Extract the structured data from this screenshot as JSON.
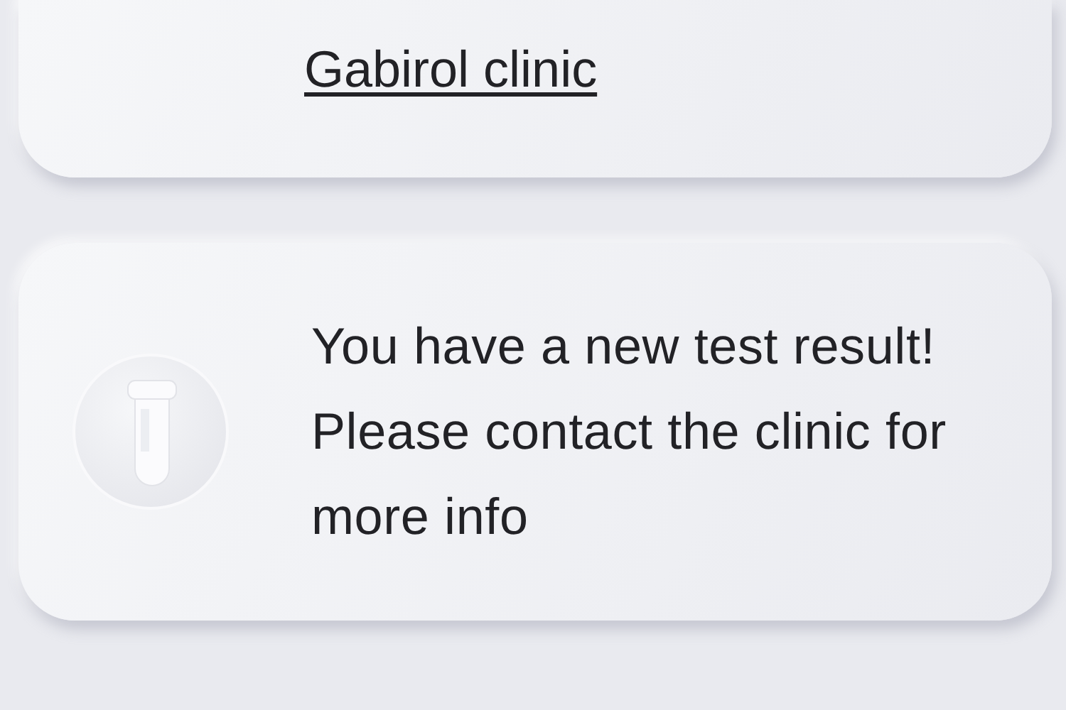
{
  "notifications": [
    {
      "kind": "appointment",
      "link": "Gabirol clinic"
    },
    {
      "kind": "test_result",
      "message": "You have a new test result! Please contact the clinic for more info"
    }
  ]
}
